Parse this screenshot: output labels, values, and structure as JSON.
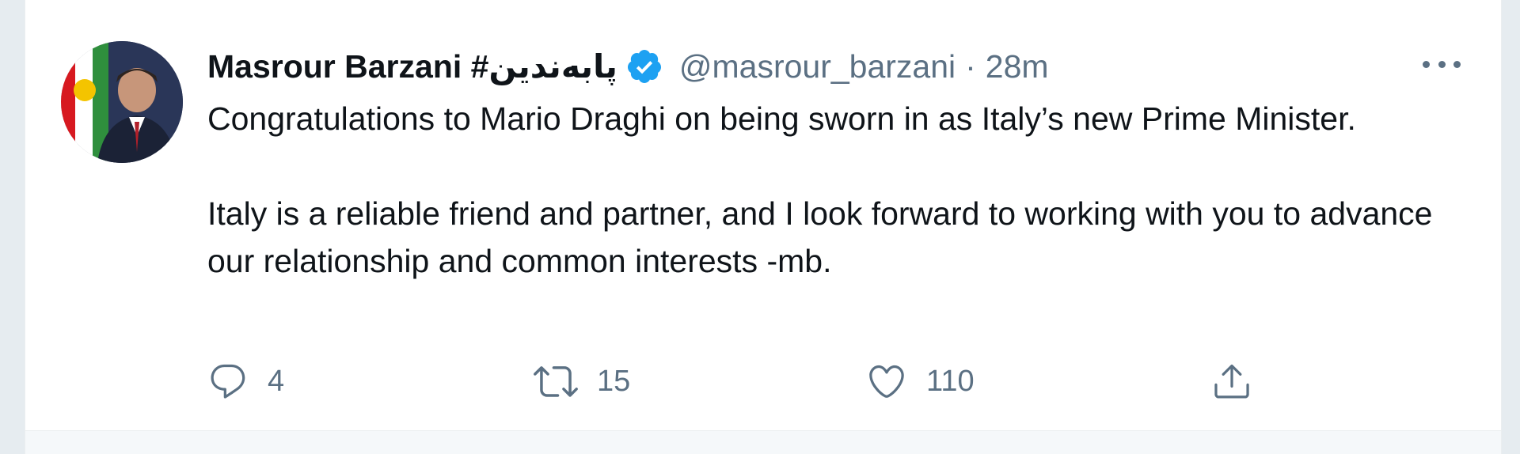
{
  "tweet": {
    "author": {
      "name": "Masrour Barzani #پابەندین",
      "handle": "@masrour_barzani",
      "verified": true
    },
    "separator": "·",
    "time": "28m",
    "text": {
      "paragraph_1": "Congratulations to Mario Draghi on being sworn in as Italy’s new Prime Minister.",
      "paragraph_2": "Italy is a reliable friend and partner, and I look forward to working with you to advance our relationship and common interests -mb."
    },
    "actions": {
      "replies": "4",
      "retweets": "15",
      "likes": "110"
    }
  },
  "icons": {
    "verified": "verified-badge-icon",
    "more": "more-horizontal-icon",
    "reply": "reply-icon",
    "retweet": "retweet-icon",
    "like": "like-icon",
    "share": "share-icon"
  },
  "colors": {
    "text_primary": "#0f1419",
    "text_secondary": "#5b7083",
    "verified_blue": "#1da1f2",
    "background": "#e6ecf0"
  }
}
